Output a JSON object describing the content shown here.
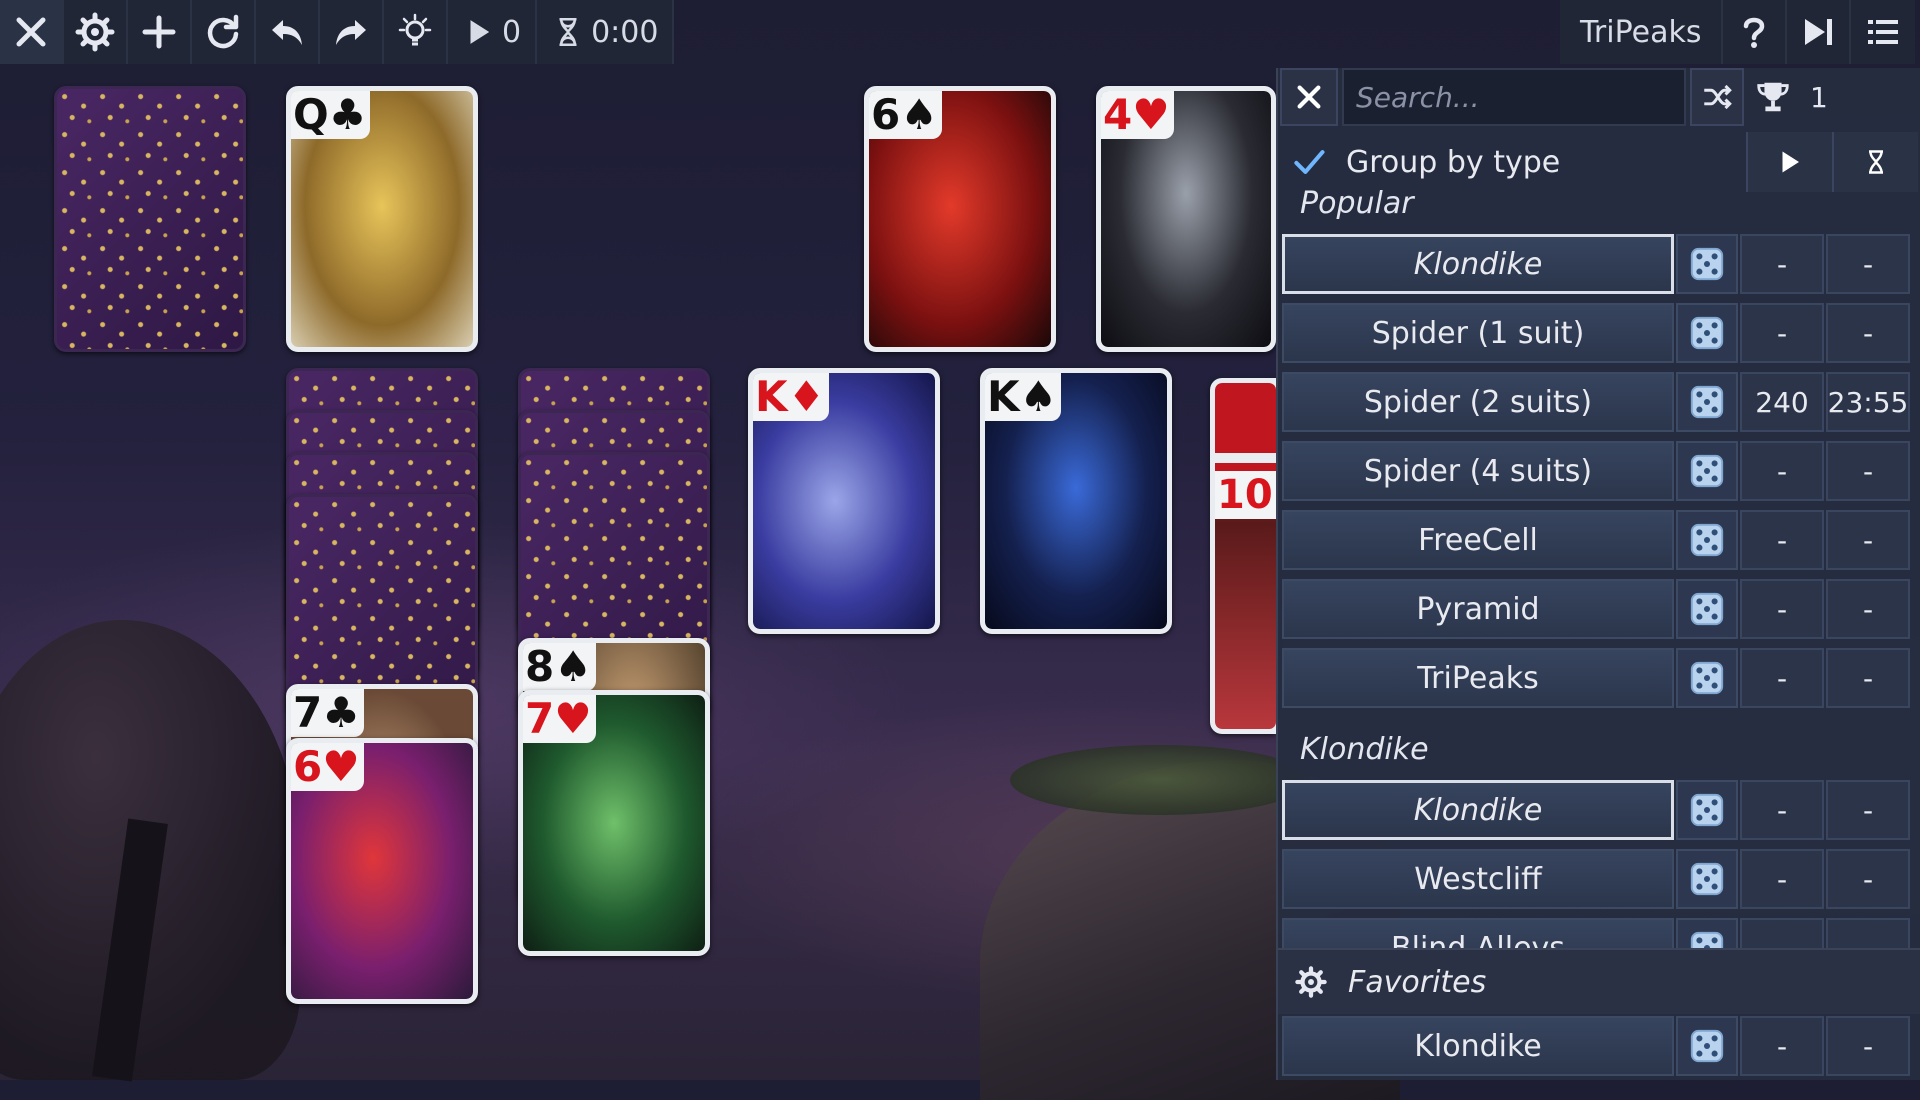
{
  "toolbar": {
    "moves": "0",
    "time": "0:00",
    "game_title": "TriPeaks"
  },
  "cards": {
    "stock_face": {
      "rank": "Q",
      "suit": "♣",
      "color": "black"
    },
    "foundation_1": {
      "rank": "6",
      "suit": "♠",
      "color": "black"
    },
    "foundation_2": {
      "rank": "4",
      "suit": "♥",
      "color": "red"
    },
    "tableau_3": {
      "rank": "K",
      "suit": "♦",
      "color": "red"
    },
    "tableau_4": {
      "rank": "K",
      "suit": "♠",
      "color": "black"
    },
    "tableau_5_partial": {
      "rank": "10",
      "suit": "♦",
      "color": "red"
    },
    "tableau_1_top": {
      "rank": "7",
      "suit": "♣",
      "color": "black"
    },
    "tableau_1_face": {
      "rank": "6",
      "suit": "♥",
      "color": "red"
    },
    "tableau_2_top": {
      "rank": "8",
      "suit": "♠",
      "color": "black"
    },
    "tableau_2_face": {
      "rank": "7",
      "suit": "♥",
      "color": "red"
    }
  },
  "panel": {
    "search_placeholder": "Search...",
    "trophy_count": "1",
    "group_by_type": "Group by type",
    "sections": {
      "popular": "Popular",
      "klondike": "Klondike",
      "favorites": "Favorites"
    },
    "popular_games": [
      {
        "name": "Klondike",
        "moves": "-",
        "time": "-"
      },
      {
        "name": "Spider (1 suit)",
        "moves": "-",
        "time": "-"
      },
      {
        "name": "Spider (2 suits)",
        "moves": "240",
        "time": "23:55"
      },
      {
        "name": "Spider (4 suits)",
        "moves": "-",
        "time": "-"
      },
      {
        "name": "FreeCell",
        "moves": "-",
        "time": "-"
      },
      {
        "name": "Pyramid",
        "moves": "-",
        "time": "-"
      },
      {
        "name": "TriPeaks",
        "moves": "-",
        "time": "-"
      }
    ],
    "klondike_games": [
      {
        "name": "Klondike",
        "moves": "-",
        "time": "-"
      },
      {
        "name": "Westcliff",
        "moves": "-",
        "time": "-"
      },
      {
        "name": "Blind Alleys",
        "moves": "",
        "time": ""
      }
    ],
    "favorite_games": [
      {
        "name": "Klondike",
        "moves": "-",
        "time": "-"
      }
    ]
  }
}
